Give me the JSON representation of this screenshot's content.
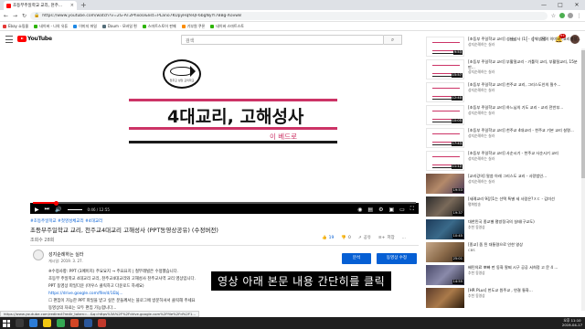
{
  "browser": {
    "tab_title": "초등부주일학교 교리, 천주...",
    "tab_close": "×",
    "new_tab": "+",
    "url": "https://www.youtube.com/watch?v=2G-AT2PhxoU&list=PLano7KUpyHqfeQF6bgNyYl7BBg-Xovw8",
    "window": {
      "minimize": "—",
      "maximize": "□",
      "close": "✕"
    }
  },
  "bookmarks": [
    {
      "label": "Ebay 쇼핑몰",
      "color": "#e53935"
    },
    {
      "label": "네이버 - 나의 유튜",
      "color": "#2db400"
    },
    {
      "label": "이미지 파일",
      "color": "#1e88e5"
    },
    {
      "label": "Daum - 모바일 편",
      "color": "#546e7a"
    },
    {
      "label": "스마트스토어 판매",
      "color": "#2db400"
    },
    {
      "label": "기부원 쿠폰",
      "color": "#fb8c00"
    },
    {
      "label": "네이버 스마트스토",
      "color": "#2db400"
    }
  ],
  "youtube": {
    "logo_text": "YouTube",
    "search_placeholder": "검색",
    "notification_count": "9+"
  },
  "player": {
    "slide_title": "4대교리, 고해성사",
    "slide_author": "이 베드로",
    "logo_text": "천주교 성당 교리학교",
    "time": "0:46 / 12:55",
    "progress": 0.06
  },
  "video": {
    "hashtags": "#초등주일학교 #첫영성체교리 #4대교리",
    "title": "초등부주일학교 교리, 천주교4대교리 고해성사 (PPT동영상공유) (수정버전)",
    "views": "조회수 28회",
    "likes": "19",
    "dislikes": "0",
    "share": "공유",
    "save": "저장",
    "more": "..."
  },
  "channel": {
    "name": "성지순례하는 실라",
    "date": "게시일: 2019. 3. 27.",
    "analytics_button": "분석",
    "edit_button": "동영상 수정"
  },
  "description": [
    "※수정사항: PPT (3페이지) 주요요지 → 주요요지 | 철부래빌은 수정했습니다.",
    "초등부 주일학교 4대교리 교리, 천주교4대교리와 고해성사 천주교사역 교리 영상입니다.",
    "PPT 동영상 파일다운 (마우스 클릭하고 다운로드 하세요)",
    "https://drive.google.com/file/d/1Ebj...",
    "☐ 편집이 가능한 PPT 파일을 받고 싶은 분들께서는 블로그에 방문하셔서 클릭해 주세요",
    "동영상의 자료는 모두 편집 가능합니다..."
  ],
  "overlay_caption": "영상 아래 본문 내용 간단히를 클릭",
  "status_url": "https://www.youtube.com/redirect?redir_token=...&q=https%3A%2F%2Fdrive.google.com%2Ffile%2Fd%2F1...",
  "sidebar": [
    {
      "title": "[초등부 주일학교 교리] 성체성사 (1) - 성체성사의 의미와 (교리평정...",
      "channel": "성지순례하는 실라",
      "duration": "9:53"
    },
    {
      "title": "[초등부 주일학교 교리] 부활절교리 - 가톨릭 교리, 부활절교리, 15분 만...",
      "channel": "성지순례하는 실라",
      "duration": "15:57"
    },
    {
      "title": "[초등부 주일학교 교리] 천주교 교리, 그리스도인의 필수...",
      "channel": "성지순례하는 실라",
      "duration": "12:40"
    },
    {
      "title": "[초등부 주일학교 교리] 하느님의 기도 교리 - 교리 전반부...",
      "channel": "성지순례하는 실라",
      "duration": "10:05"
    },
    {
      "title": "[초등부 주일학교 교리] 천주교 4대교리 - 천주교 기본 교리 설명...",
      "channel": "성지순례하는 실라",
      "duration": "17:43"
    },
    {
      "title": "[초등부 주일학교 교리] 사순시기 - 천주교 사순시기 교리",
      "channel": "성지순례하는 실라",
      "duration": "11:12"
    },
    {
      "title": "[교리강의] 말씀 아래 그리스도 교리 - 사랑법인...",
      "channel": "성지순례하는 실라",
      "duration": "19:53"
    },
    {
      "title": "[세례교리 9강]1는 선택 특별 세 사람은?ㅈㄷ - 김미선",
      "channel": "평화방송",
      "duration": "19:37"
    },
    {
      "title": "대한민국 종교별 평방정국의 실태(구교도)",
      "channel": "추천 동영상",
      "duration": "10:45"
    },
    {
      "title": "[종교] 좀 된 대통령으로 인한 영상",
      "channel": "CBS",
      "duration": "25:01"
    },
    {
      "title": "배민의료 뽀빠 펀 동화 팔찌 시구 공공 서희정 고 문 4 ...",
      "channel": "추천 동영상",
      "duration": "14:55"
    },
    {
      "title": "[HR PLus] 천도교 원주교 , 연결 통화...",
      "channel": "추천 동영상",
      "duration": ""
    }
  ],
  "taskbar": {
    "clock_time": "오후 11:10",
    "clock_date": "2019-04-17"
  }
}
